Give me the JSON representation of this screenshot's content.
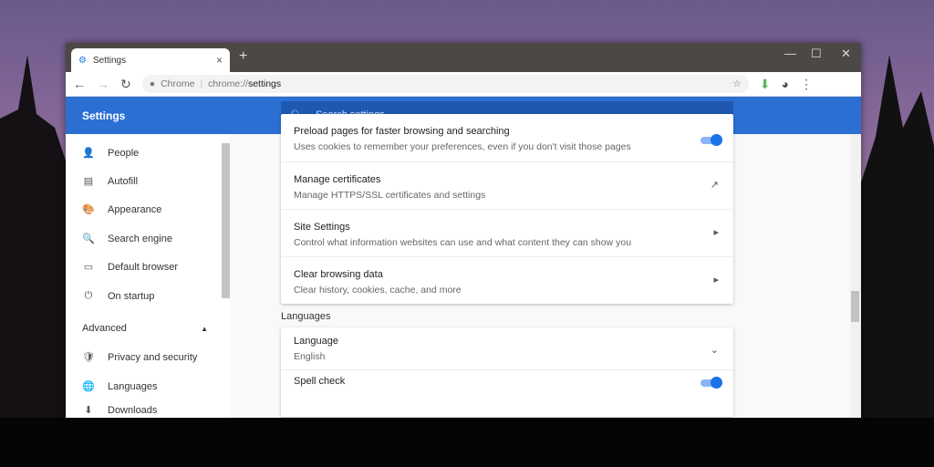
{
  "tab": {
    "title": "Settings",
    "close": "×",
    "new": "+"
  },
  "window_controls": {
    "minimize": "—",
    "maximize": "☐",
    "close": "✕"
  },
  "omnibox": {
    "site": "Chrome",
    "url_prefix": "chrome://",
    "url_path": "settings"
  },
  "header": {
    "title": "Settings",
    "search_placeholder": "Search settings"
  },
  "sidebar": {
    "items": [
      {
        "label": "People",
        "icon": "👤"
      },
      {
        "label": "Autofill",
        "icon": "▤"
      },
      {
        "label": "Appearance",
        "icon": "🎨"
      },
      {
        "label": "Search engine",
        "icon": "🔍"
      },
      {
        "label": "Default browser",
        "icon": "▭"
      },
      {
        "label": "On startup",
        "icon": "⏻"
      }
    ],
    "advanced": "Advanced",
    "advanced_items": [
      {
        "label": "Privacy and security",
        "icon": "🛡"
      },
      {
        "label": "Languages",
        "icon": "🌐"
      },
      {
        "label": "Downloads",
        "icon": "⬇"
      }
    ]
  },
  "privacy_rows": [
    {
      "title": "Preload pages for faster browsing and searching",
      "subtitle": "Uses cookies to remember your preferences, even if you don't visit those pages",
      "control": "toggle-on"
    },
    {
      "title": "Manage certificates",
      "subtitle": "Manage HTTPS/SSL certificates and settings",
      "control": "↗"
    },
    {
      "title": "Site Settings",
      "subtitle": "Control what information websites can use and what content they can show you",
      "control": "▸"
    },
    {
      "title": "Clear browsing data",
      "subtitle": "Clear history, cookies, cache, and more",
      "control": "▸"
    }
  ],
  "languages": {
    "heading": "Languages",
    "language_label": "Language",
    "language_value": "English",
    "spell_check": "Spell check"
  }
}
